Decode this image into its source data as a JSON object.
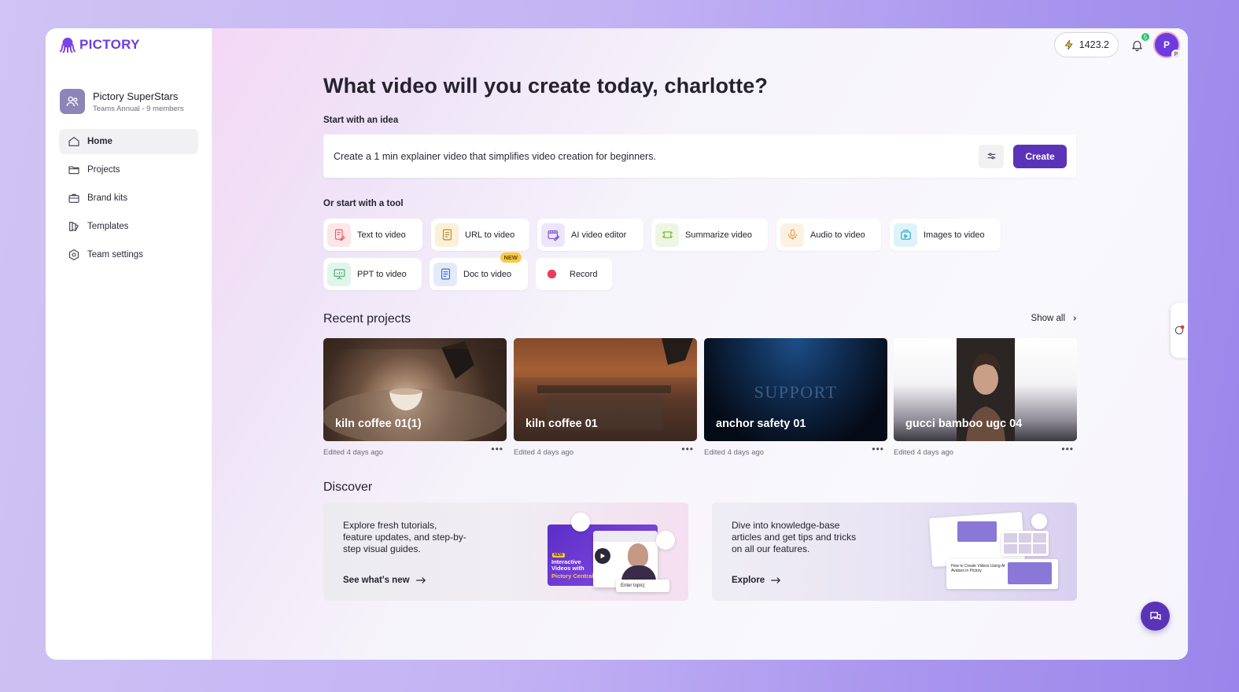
{
  "brand": {
    "name": "PICTORY",
    "color": "#6b3fe0"
  },
  "team": {
    "name": "Pictory SuperStars",
    "plan": "Teams Annual - 9 members"
  },
  "sidebar": {
    "items": [
      {
        "label": "Home",
        "icon": "home-icon",
        "active": true
      },
      {
        "label": "Projects",
        "icon": "folder-icon",
        "active": false
      },
      {
        "label": "Brand kits",
        "icon": "briefcase-icon",
        "active": false
      },
      {
        "label": "Templates",
        "icon": "template-icon",
        "active": false
      },
      {
        "label": "Team settings",
        "icon": "gear-icon",
        "active": false
      }
    ]
  },
  "topbar": {
    "credits": "1423.2",
    "notifications": "5",
    "avatar_initial": "P",
    "avatar_sub": "P"
  },
  "headline": "What video will you create today, charlotte?",
  "idea": {
    "label": "Start with an idea",
    "value": "Create a 1 min explainer video that simplifies video creation for beginners.",
    "create_label": "Create"
  },
  "tools": {
    "label": "Or start with a tool",
    "items": [
      {
        "label": "Text to video",
        "icon": "text-video-icon",
        "color": "#e45c6a"
      },
      {
        "label": "URL to video",
        "icon": "url-document-icon",
        "color": "#c08a26"
      },
      {
        "label": "AI video editor",
        "icon": "video-edit-icon",
        "color": "#7b57d6"
      },
      {
        "label": "Summarize video",
        "icon": "summarize-icon",
        "color": "#7ab33a"
      },
      {
        "label": "Audio to video",
        "icon": "microphone-icon",
        "color": "#e59a3b"
      },
      {
        "label": "Images to video",
        "icon": "images-icon",
        "color": "#2aa7c9"
      },
      {
        "label": "PPT to video",
        "icon": "presentation-icon",
        "color": "#3fae6b"
      },
      {
        "label": "Doc to video",
        "icon": "document-icon",
        "color": "#3d6fd8",
        "badge": "NEW"
      },
      {
        "label": "Record",
        "icon": "record-icon",
        "color": "#ef3b5d"
      }
    ]
  },
  "recent": {
    "title": "Recent projects",
    "show_all": "Show all",
    "projects": [
      {
        "title": "kiln coffee 01(1)",
        "meta": "Edited 4 days ago"
      },
      {
        "title": "kiln coffee 01",
        "meta": "Edited 4 days ago"
      },
      {
        "title": "anchor safety 01",
        "meta": "Edited 4 days ago",
        "thumb_text": "SUPPORT"
      },
      {
        "title": "gucci bamboo ugc 04",
        "meta": "Edited 4 days ago"
      }
    ]
  },
  "discover": {
    "title": "Discover",
    "cards": [
      {
        "text": "Explore fresh tutorials, feature updates, and step-by-step visual guides.",
        "link": "See what's new",
        "art_badge": "NEW",
        "art_title": "Interactive Videos with",
        "art_brand": "Pictory Central",
        "art_input": "Enter topic|"
      },
      {
        "text": "Dive into knowledge-base articles and get tips and tricks on all our features.",
        "link": "Explore",
        "art_caption": "How to Create Videos Using AI Avatars in Pictory"
      }
    ]
  }
}
